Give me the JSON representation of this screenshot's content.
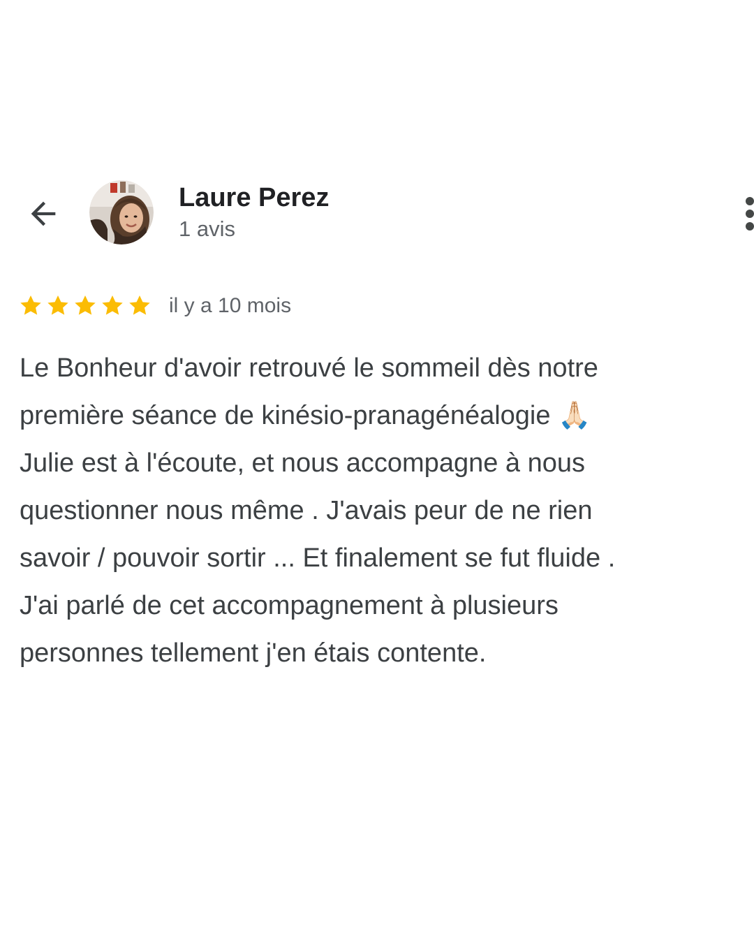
{
  "reviewer": {
    "name": "Laure Perez",
    "review_count": "1 avis",
    "avatar_icon": "user-photo"
  },
  "header": {
    "back_icon": "arrow-back-icon",
    "more_icon": "more-vert-icon"
  },
  "rating": {
    "stars": 5,
    "max_stars": 5,
    "star_color": "#fbbc04",
    "date": "il y a 10 mois"
  },
  "review": {
    "lines": [
      "Le Bonheur d'avoir retrouvé le sommeil dès notre",
      "première séance de kinésio-pranagénéalogie 🙏🏻",
      "Julie est à l'écoute, et nous accompagne à nous",
      "questionner nous même . J'avais peur de ne rien",
      "savoir / pouvoir sortir ... Et finalement se fut fluide .",
      "J'ai parlé de cet accompagnement à plusieurs",
      "personnes tellement j'en étais contente."
    ]
  },
  "colors": {
    "primary_text": "#202124",
    "secondary_text": "#5f6368",
    "body_text": "#3c4043",
    "background": "#ffffff"
  }
}
